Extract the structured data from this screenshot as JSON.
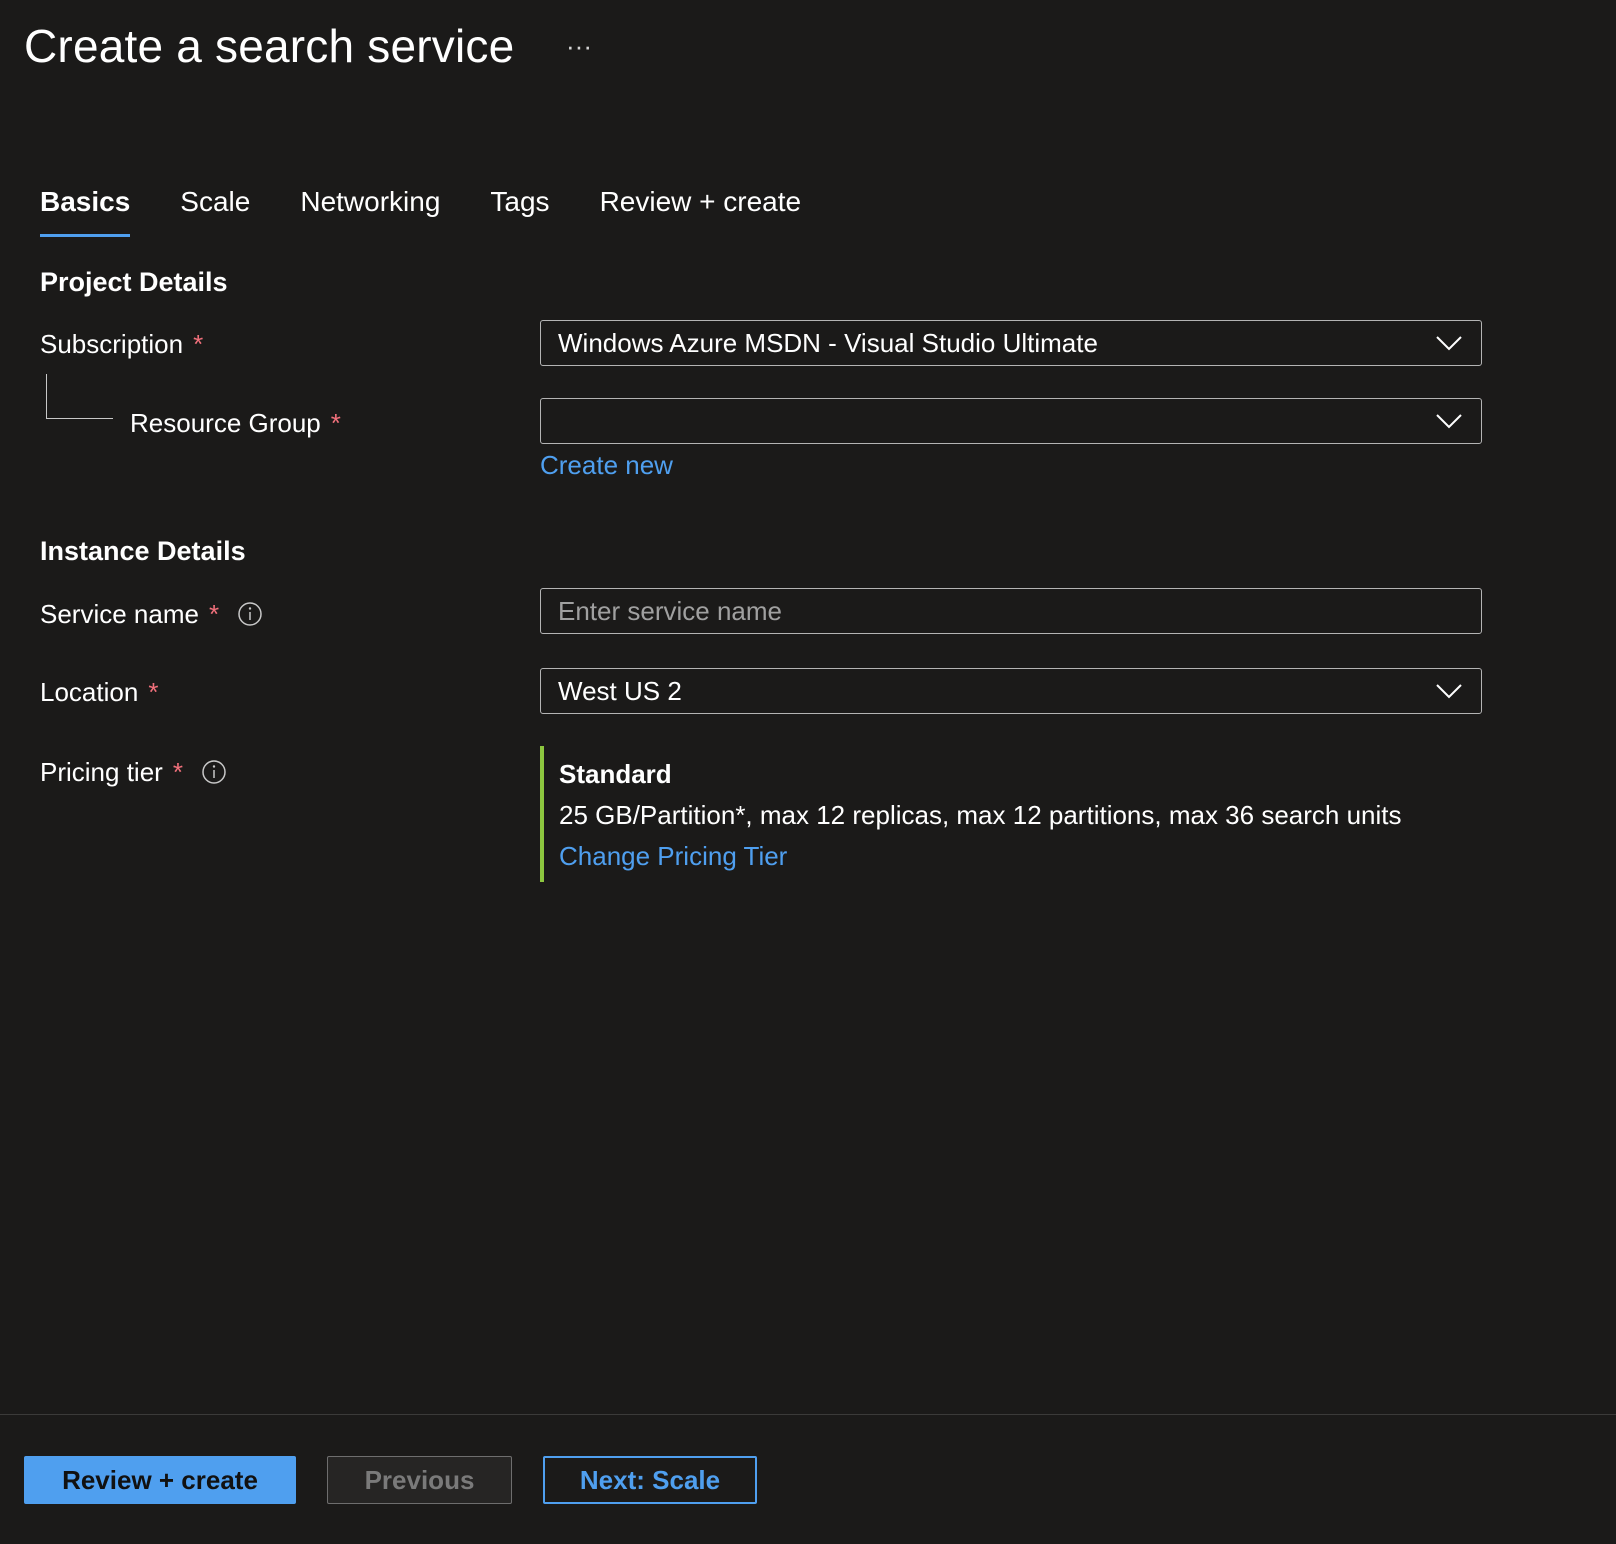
{
  "header": {
    "title": "Create a search service",
    "more_icon": "ellipsis-icon",
    "more_label": "···"
  },
  "tabs": [
    {
      "label": "Basics",
      "active": true
    },
    {
      "label": "Scale",
      "active": false
    },
    {
      "label": "Networking",
      "active": false
    },
    {
      "label": "Tags",
      "active": false
    },
    {
      "label": "Review + create",
      "active": false
    }
  ],
  "project_details": {
    "heading": "Project Details",
    "subscription": {
      "label": "Subscription",
      "required_mark": "*",
      "value": "Windows Azure MSDN - Visual Studio Ultimate"
    },
    "resource_group": {
      "label": "Resource Group",
      "required_mark": "*",
      "value": "",
      "create_new_label": "Create new"
    }
  },
  "instance_details": {
    "heading": "Instance Details",
    "service_name": {
      "label": "Service name",
      "required_mark": "*",
      "value": "",
      "placeholder": "Enter service name"
    },
    "location": {
      "label": "Location",
      "required_mark": "*",
      "value": "West US 2"
    },
    "pricing_tier": {
      "label": "Pricing tier",
      "required_mark": "*",
      "tier_name": "Standard",
      "tier_description": "25 GB/Partition*, max 12 replicas, max 12 partitions, max 36 search units",
      "change_label": "Change Pricing Tier"
    }
  },
  "footer": {
    "review_create_label": "Review + create",
    "previous_label": "Previous",
    "next_label": "Next: Scale"
  },
  "colors": {
    "background": "#1b1a19",
    "accent": "#4f9fef",
    "required": "#f1707b",
    "tier_bar": "#8dc63f"
  }
}
